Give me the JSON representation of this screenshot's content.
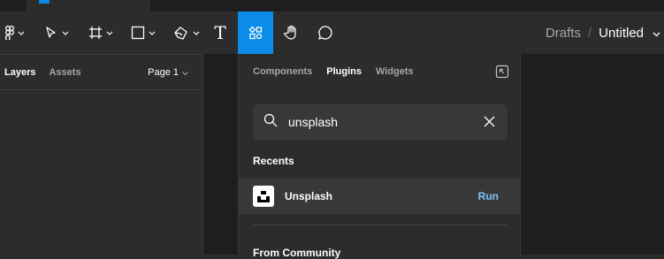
{
  "toolbar": {
    "tools": [
      {
        "name": "main-menu",
        "icon": "figma-logo-icon"
      },
      {
        "name": "move",
        "icon": "cursor-icon"
      },
      {
        "name": "frame",
        "icon": "frame-hash-icon"
      },
      {
        "name": "shape",
        "icon": "rectangle-icon"
      },
      {
        "name": "pen",
        "icon": "pen-nib-icon"
      },
      {
        "name": "text",
        "icon": "text-t-icon",
        "label": "T"
      },
      {
        "name": "resources",
        "icon": "resources-grid-icon",
        "active": true
      },
      {
        "name": "hand",
        "icon": "hand-icon"
      },
      {
        "name": "comment",
        "icon": "speech-bubble-icon"
      }
    ],
    "accent": "#0c8ce9"
  },
  "breadcrumb": {
    "location": "Drafts",
    "separator": "/",
    "file_title": "Untitled"
  },
  "left_panel": {
    "tab_layers": "Layers",
    "tab_assets": "Assets",
    "page_selector": "Page 1"
  },
  "resources": {
    "tabs": [
      "Components",
      "Plugins",
      "Widgets"
    ],
    "active_tab": "Plugins",
    "search": {
      "value": "unsplash",
      "placeholder": ""
    },
    "recents_heading": "Recents",
    "recent_plugins": [
      {
        "name": "Unsplash",
        "action": "Run",
        "action_color": "#7cc4f8"
      }
    ],
    "community_heading": "From Community"
  }
}
